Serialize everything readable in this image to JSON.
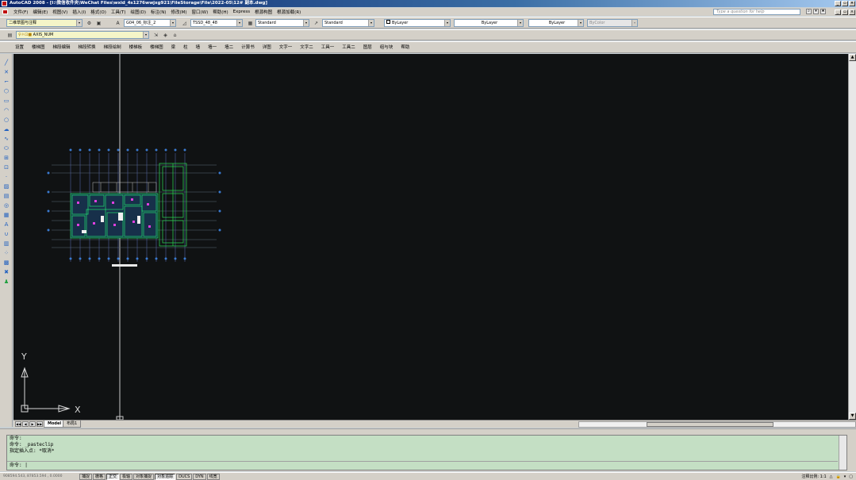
{
  "window": {
    "title": "AutoCAD 2008 - [I:\\微信收件夹\\WeChat Files\\wxid_4s1276wwjxg921\\FileStorage\\File\\2022-05\\12#   副本.dwg]",
    "min": "_",
    "max": "▫",
    "close": "×"
  },
  "menu": {
    "items": [
      "文件(F)",
      "编辑(E)",
      "视图(V)",
      "插入(I)",
      "格式(O)",
      "工具(T)",
      "绘图(D)",
      "标注(N)",
      "修改(M)",
      "窗口(W)",
      "帮助(H)",
      "Express",
      "根源构图",
      "根源加载(R)"
    ],
    "help_placeholder": "Type a question for help"
  },
  "toolbar1": {
    "workspace": "二维草图与注释",
    "textstyle": "G04_06_标注_2",
    "dimstyle": "TSSD_48_48",
    "tablestyle": "Standard",
    "mlstyle": "Standard",
    "layer_color": "ByLayer",
    "linetype": "ByLayer",
    "lineweight": "ByLayer",
    "plotstyle": "ByColor"
  },
  "toolbar2": {
    "layer": "AXIS_NUM"
  },
  "toolbar3": {
    "items": [
      "设置",
      "楼梯图",
      "梯段编辑",
      "梯段转换",
      "梯段绘制",
      "楼梯板",
      "楼梯图",
      "梁",
      "柱",
      "墙",
      "墙一",
      "墙二",
      "计算书",
      "详图",
      "文字一",
      "文字二",
      "工具一",
      "工具二",
      "图层",
      "组与块",
      "帮助"
    ]
  },
  "canvas": {
    "bg": "#101213",
    "ucs_x": "X",
    "ucs_y": "Y"
  },
  "tabs": {
    "model": "Model",
    "layout": "布局1"
  },
  "command": {
    "lines": [
      "命令:",
      "命令: _pasteclip",
      "指定插入点: *取消*"
    ],
    "prompt": "命令:"
  },
  "status": {
    "coords": "908594.543, 87853.594 , 0.0000",
    "buttons": [
      "捕捉",
      "栅格",
      "正交",
      "极轴",
      "对象捕捉",
      "对象追踪",
      "DUCS",
      "DYN",
      "线宽"
    ],
    "active": [
      false,
      false,
      true,
      false,
      false,
      true,
      false,
      false,
      false
    ],
    "annotation_scale": "注释比例: 1:1"
  }
}
